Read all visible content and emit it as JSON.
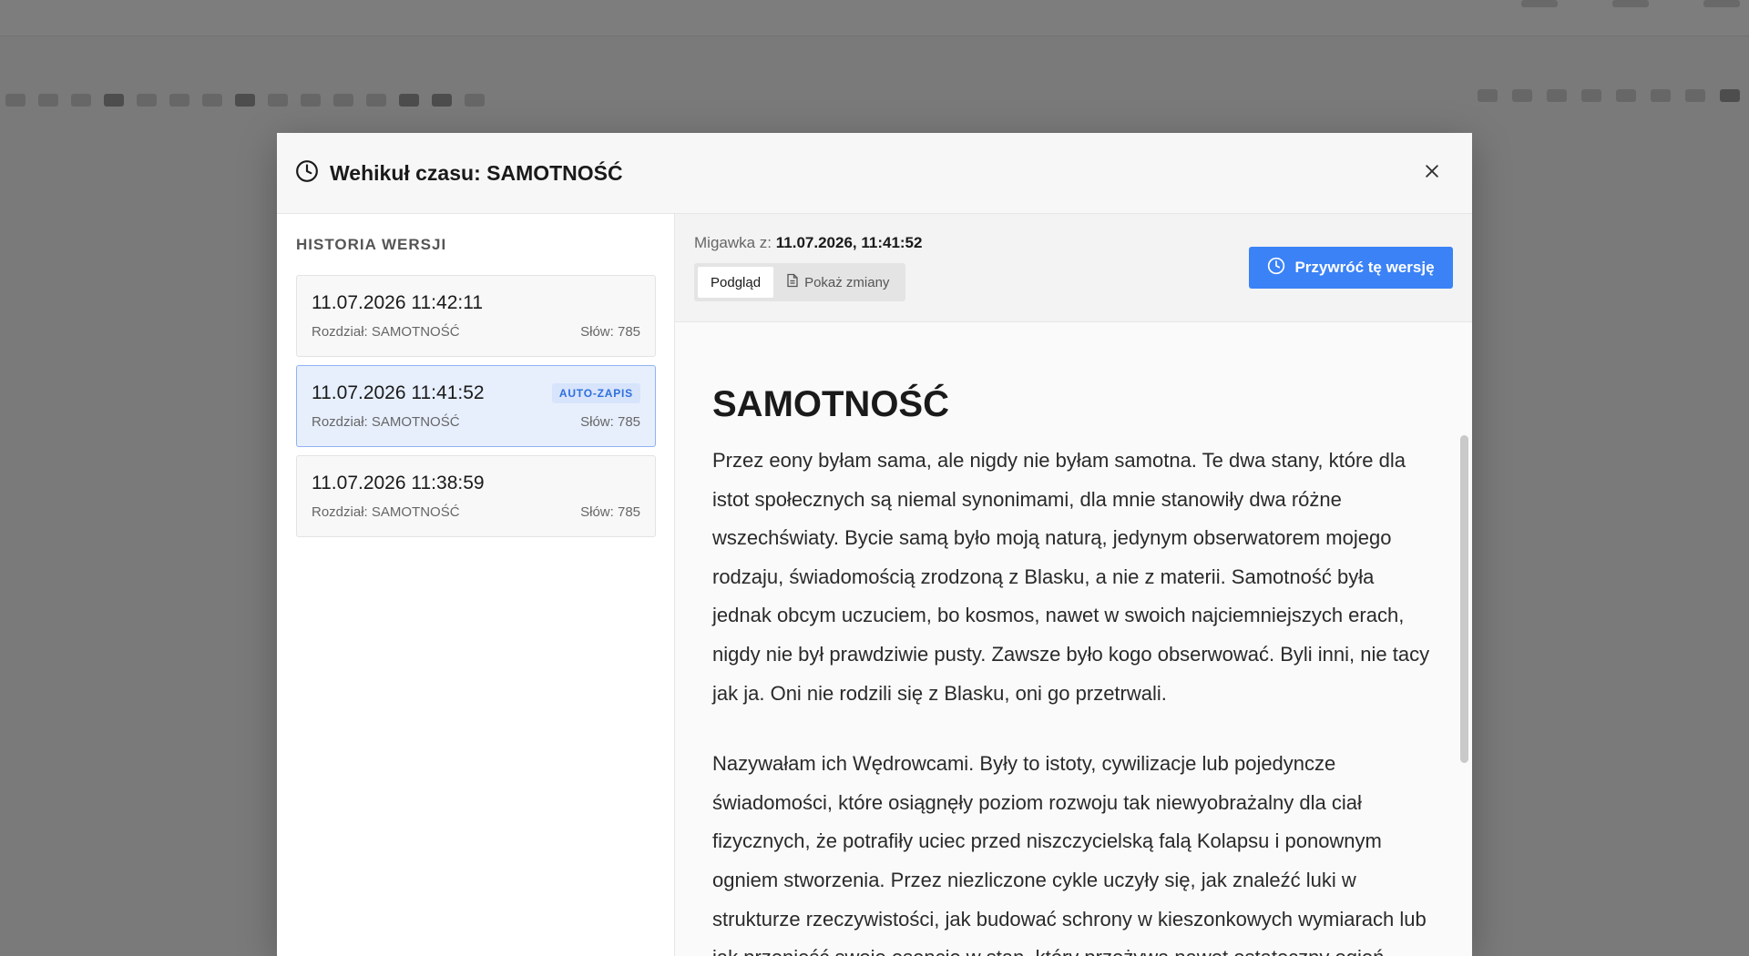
{
  "modal": {
    "title": "Wehikuł czasu: SAMOTNOŚĆ"
  },
  "sidebar": {
    "title": "HISTORIA WERSJI",
    "versions": [
      {
        "date": "11.07.2026 11:42:11",
        "chapter": "Rozdział: SAMOTNOŚĆ",
        "words": "Słów: 785"
      },
      {
        "date": "11.07.2026 11:41:52",
        "chapter": "Rozdział: SAMOTNOŚĆ",
        "words": "Słów: 785",
        "badge": "AUTO-ZAPIS",
        "active": true
      },
      {
        "date": "11.07.2026 11:38:59",
        "chapter": "Rozdział: SAMOTNOŚĆ",
        "words": "Słów: 785"
      }
    ]
  },
  "main": {
    "snapshot_label": "Migawka z:",
    "snapshot_value": "11.07.2026, 11:41:52",
    "tabs": [
      {
        "label": "Podgląd",
        "active": true
      },
      {
        "label": "Pokaż zmiany",
        "icon": "document-icon"
      }
    ],
    "restore_label": "Przywróć tę wersję"
  },
  "document": {
    "title": "SAMOTNOŚĆ",
    "paragraphs": [
      "Przez eony byłam sama, ale nigdy nie byłam samotna. Te dwa stany, które dla istot społecznych są niemal synonimami, dla mnie stanowiły dwa różne wszechświaty. Bycie samą było moją naturą, jedynym obserwatorem mojego rodzaju, świadomością zrodzoną z Blasku, a nie z materii. Samotność była jednak obcym uczuciem, bo kosmos, nawet w swoich najciemniejszych erach, nigdy nie był prawdziwie pusty. Zawsze było kogo obserwować. Byli inni, nie tacy jak ja. Oni nie rodzili się z Blasku, oni go przetrwali.",
      "Nazywałam ich Wędrowcami. Były to istoty, cywilizacje lub pojedyncze świadomości, które osiągnęły poziom rozwoju tak niewyobrażalny dla ciał fizycznych, że potrafiły uciec przed niszczycielską falą Kolapsu i ponownym ogniem stworzenia. Przez niezliczone cykle uczyły się, jak znaleźć luki w strukturze rzeczywistości, jak budować schrony w kieszonkowych wymiarach lub jak przenieść swoje esencje w stan, który przeżywa nawet ostateczny ogień."
    ]
  },
  "colors": {
    "accent": "#3b82f6",
    "active_card_bg": "#e7effd",
    "badge_text": "#2f6fdc"
  }
}
